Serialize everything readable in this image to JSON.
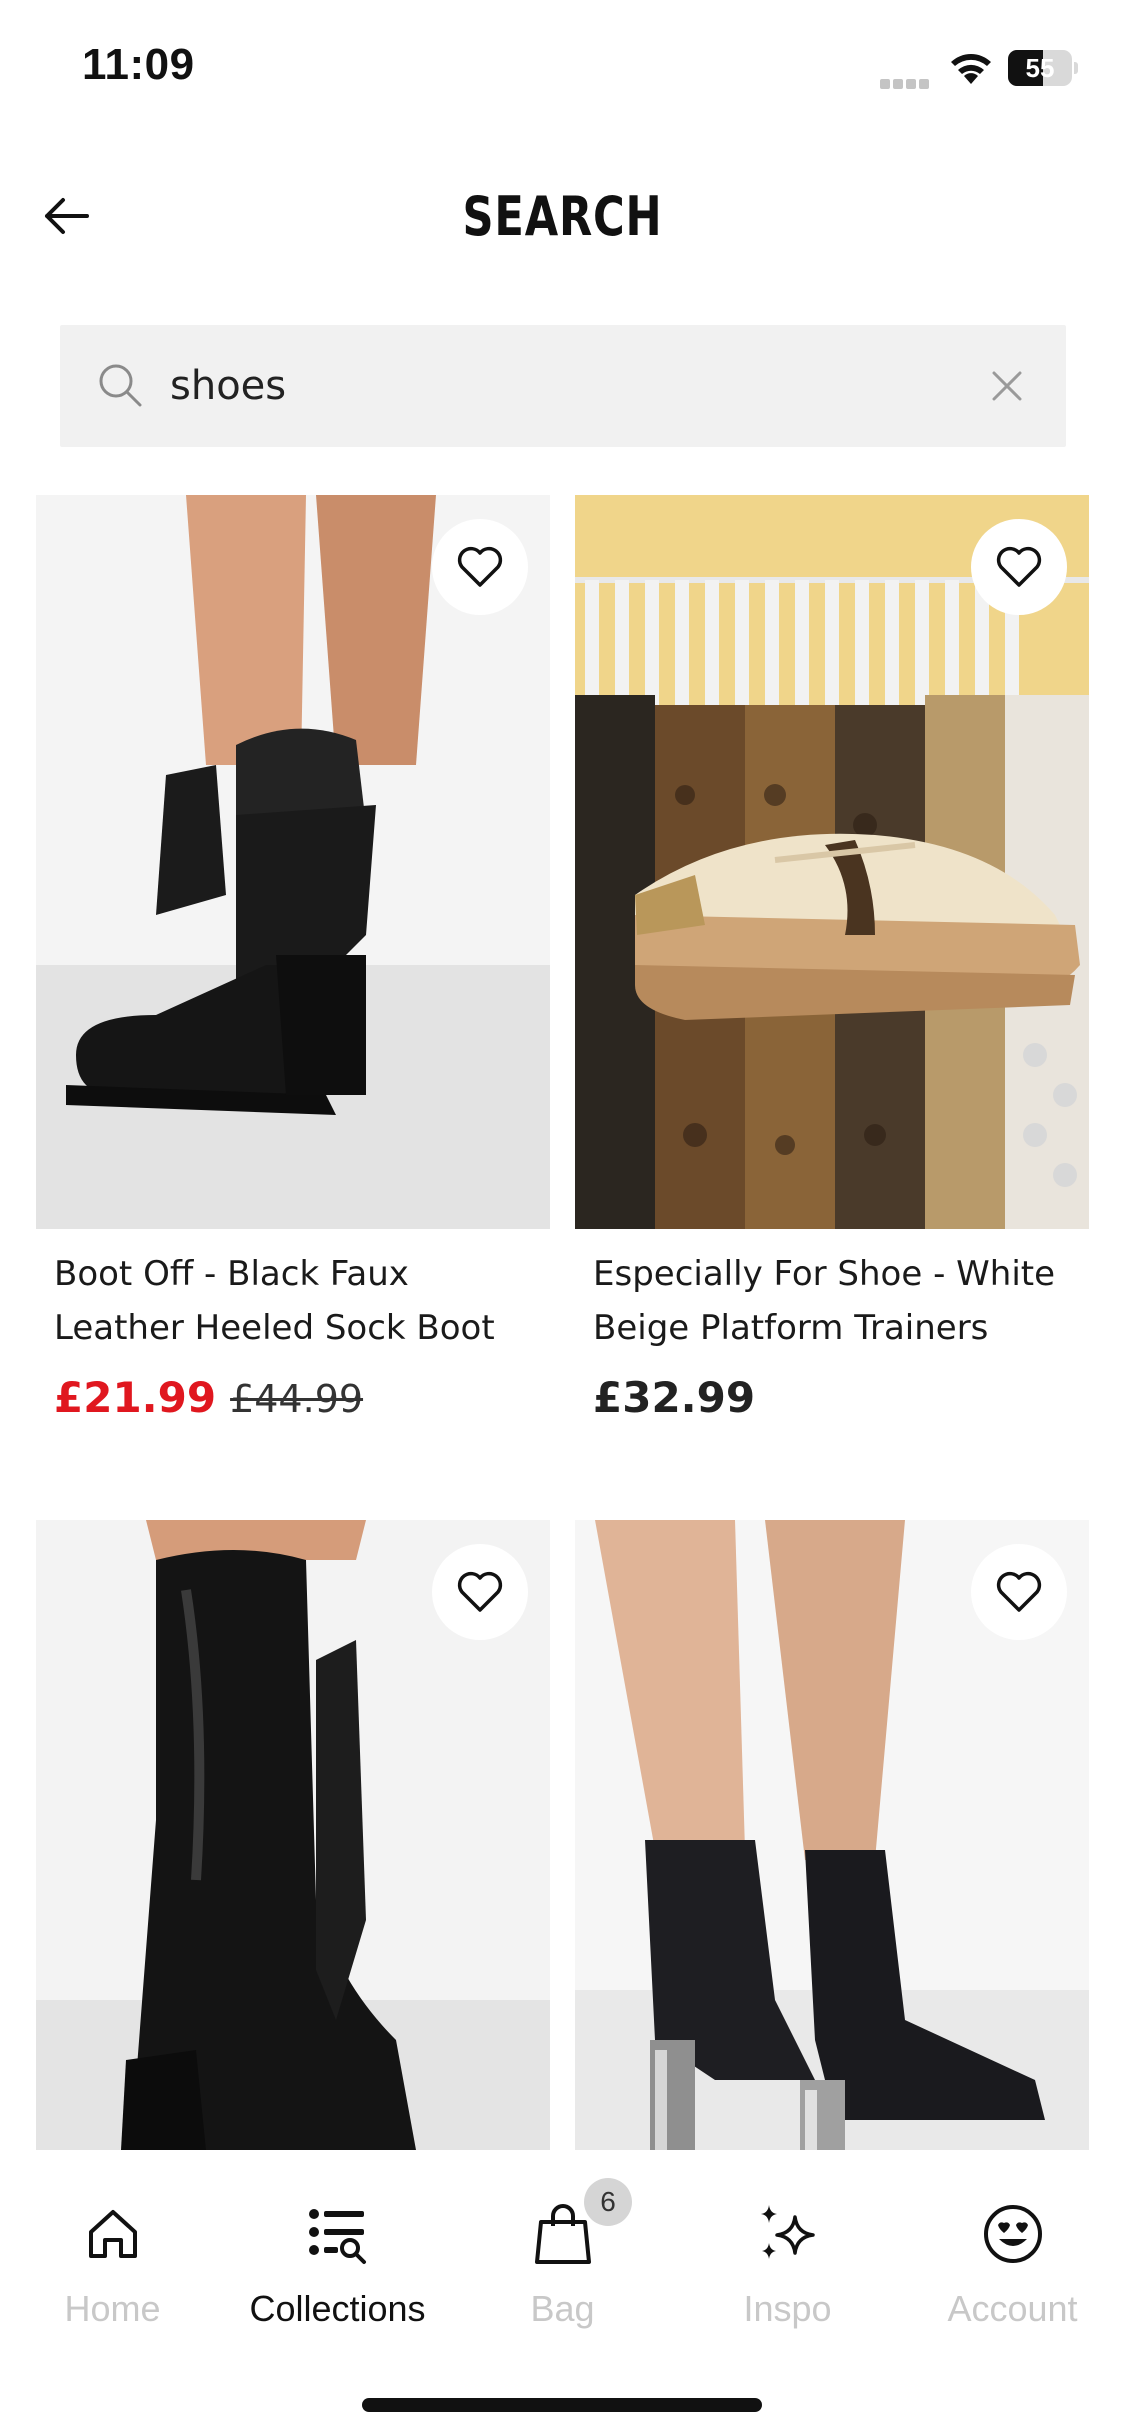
{
  "status_bar": {
    "time": "11:09",
    "battery": "55",
    "battery_percent": 55
  },
  "header": {
    "title": "SEARCH",
    "back_icon": "arrow-left-icon"
  },
  "search": {
    "value": "shoes",
    "placeholder": "Search",
    "search_icon": "magnifier-icon",
    "clear_icon": "close-icon"
  },
  "products": [
    {
      "name": "Boot Off - Black Faux Leather Heeled Sock Boot",
      "price_sale": "£21.99",
      "price_old": "£44.99"
    },
    {
      "name": "Especially For Shoe - White Beige Platform Trainers",
      "price": "£32.99"
    },
    {
      "name": "",
      "price": ""
    },
    {
      "name": "",
      "price": ""
    }
  ],
  "nav": {
    "items": [
      {
        "label": "Home",
        "icon": "home-icon",
        "active": false
      },
      {
        "label": "Collections",
        "icon": "collections-icon",
        "active": true
      },
      {
        "label": "Bag",
        "icon": "bag-icon",
        "active": false,
        "badge": "6"
      },
      {
        "label": "Inspo",
        "icon": "sparkles-icon",
        "active": false
      },
      {
        "label": "Account",
        "icon": "smiley-icon",
        "active": false
      }
    ]
  },
  "colors": {
    "sale_red": "#e0171f",
    "search_bg": "#f1f1f1",
    "inactive_nav": "#c8c8c8"
  }
}
